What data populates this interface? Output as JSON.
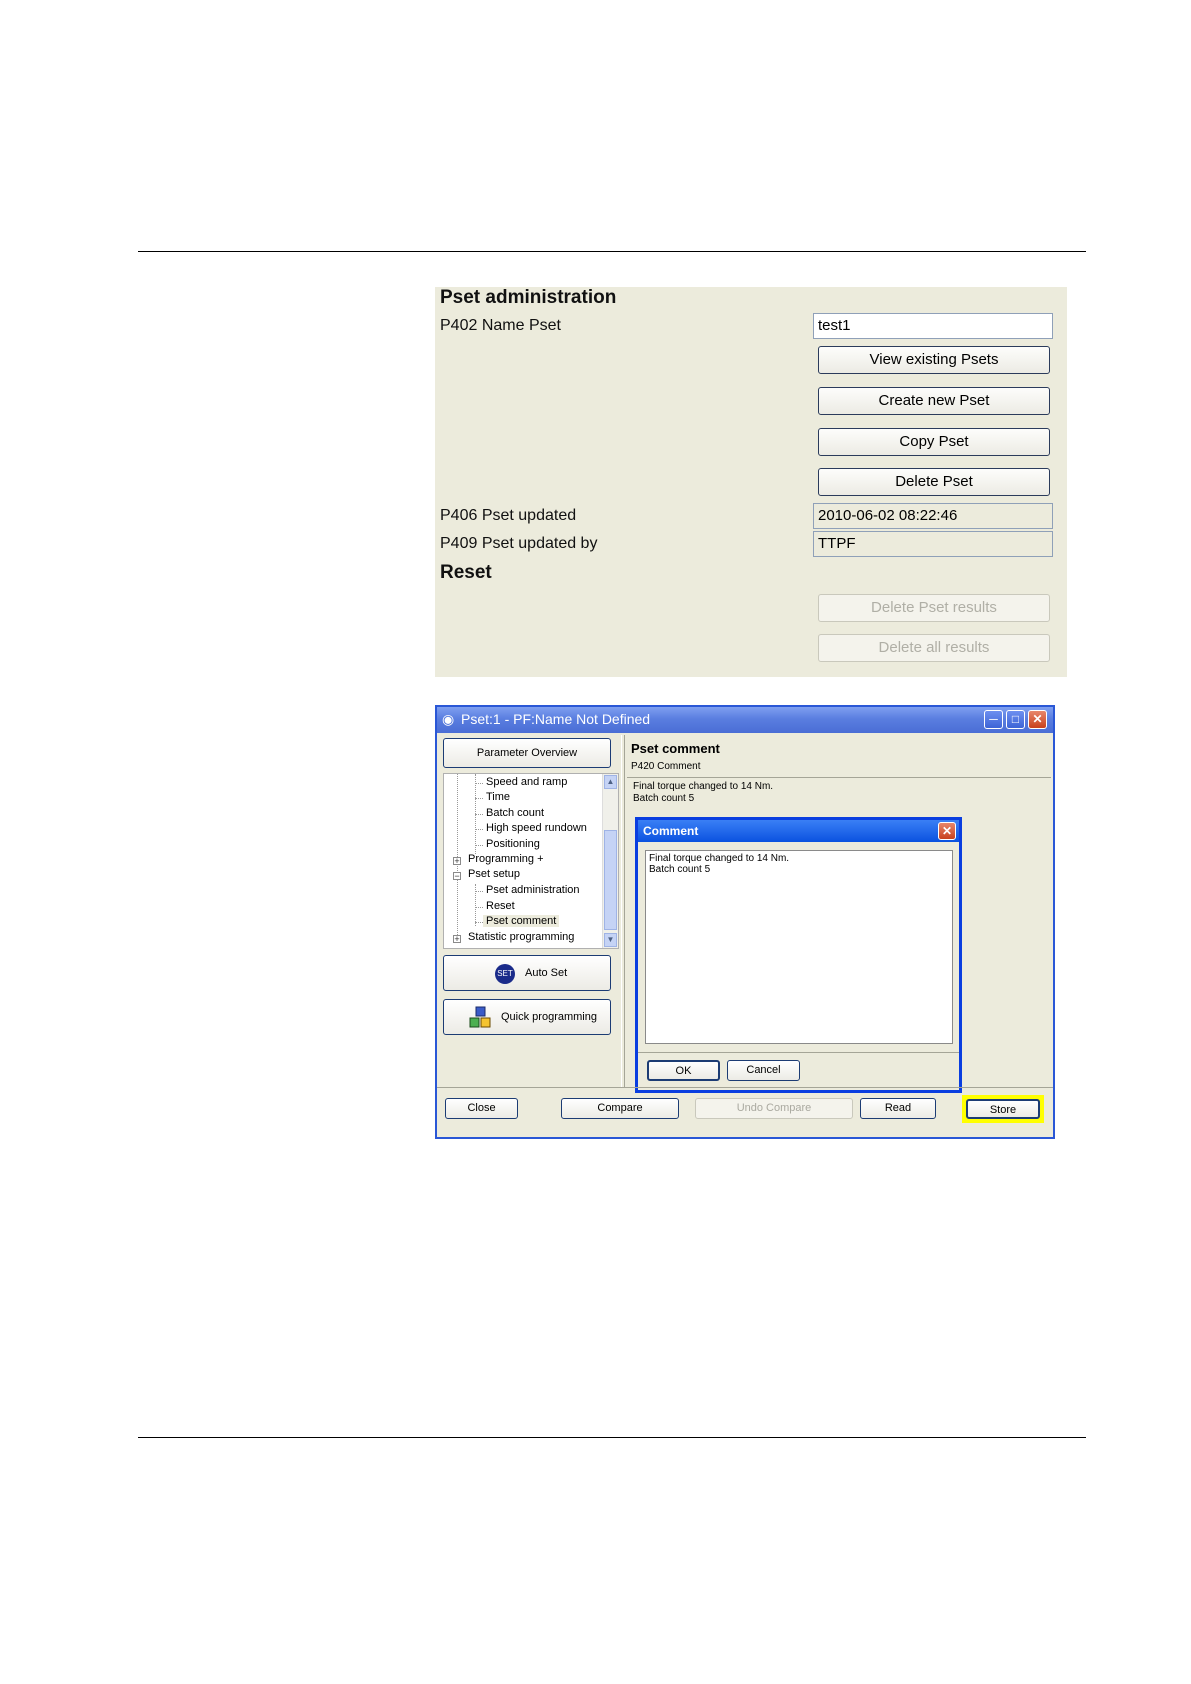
{
  "panel1": {
    "title": "Pset administration",
    "name_label": "P402 Name Pset",
    "name_value": "test1",
    "buttons": {
      "view": "View existing Psets",
      "create": "Create new Pset",
      "copy": "Copy Pset",
      "delete": "Delete Pset"
    },
    "updated_label": "P406 Pset updated",
    "updated_value": "2010-06-02 08:22:46",
    "updated_by_label": "P409 Pset updated by",
    "updated_by_value": "TTPF",
    "reset_title": "Reset",
    "reset_buttons": {
      "delete_results": "Delete Pset results",
      "delete_all": "Delete all results"
    }
  },
  "window": {
    "title": "Pset:1 - PF:Name Not Defined",
    "parameter_overview": "Parameter Overview",
    "tree": [
      "Speed and ramp",
      "Time",
      "Batch count",
      "High speed rundown",
      "Positioning",
      "Programming +",
      "Pset setup",
      "Pset administration",
      "Reset",
      "Pset comment",
      "Statistic programming"
    ],
    "auto_set": "Auto Set",
    "auto_set_badge": "SET",
    "quick_programming": "Quick programming",
    "right": {
      "heading": "Pset comment",
      "sub": "P420 Comment",
      "comment_line1": "Final torque changed to 14 Nm.",
      "comment_line2": "Batch count 5"
    },
    "dialog": {
      "title": "Comment",
      "text_line1": "Final torque changed to 14 Nm.",
      "text_line2": "Batch count 5",
      "ok": "OK",
      "cancel": "Cancel"
    },
    "bottom": {
      "close": "Close",
      "compare": "Compare",
      "undo_compare": "Undo Compare",
      "read": "Read",
      "store": "Store"
    },
    "highlight_color": "#ffff00"
  }
}
